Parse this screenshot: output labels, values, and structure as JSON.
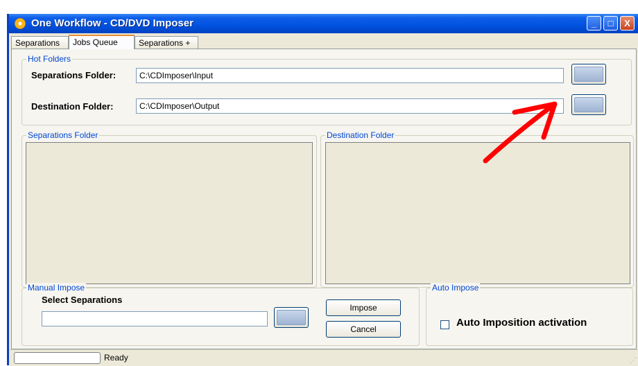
{
  "window": {
    "title": "One Workflow - CD/DVD Imposer",
    "controls": {
      "minimize": "_",
      "maximize": "□",
      "close": "X"
    }
  },
  "tabs": [
    {
      "label": "Separations"
    },
    {
      "label": "Jobs Queue",
      "active": true
    },
    {
      "label": "Separations +"
    }
  ],
  "hot_folders": {
    "group_label": "Hot Folders",
    "separations_label": "Separations Folder:",
    "separations_value": "C:\\CDImposer\\Input",
    "destination_label": "Destination Folder:",
    "destination_value": "C:\\CDImposer\\Output"
  },
  "separations_folder": {
    "group_label": "Separations Folder"
  },
  "destination_folder": {
    "group_label": "Destination Folder"
  },
  "manual_impose": {
    "group_label": "Manual Impose",
    "select_label": "Select Separations",
    "input_value": "",
    "impose_button": "Impose",
    "cancel_button": "Cancel"
  },
  "auto_impose": {
    "group_label": "Auto Impose",
    "checkbox_label": "Auto Imposition activation",
    "checked": false
  },
  "status_bar": {
    "text": "Ready"
  },
  "annotation": {
    "color": "#ff0000"
  }
}
